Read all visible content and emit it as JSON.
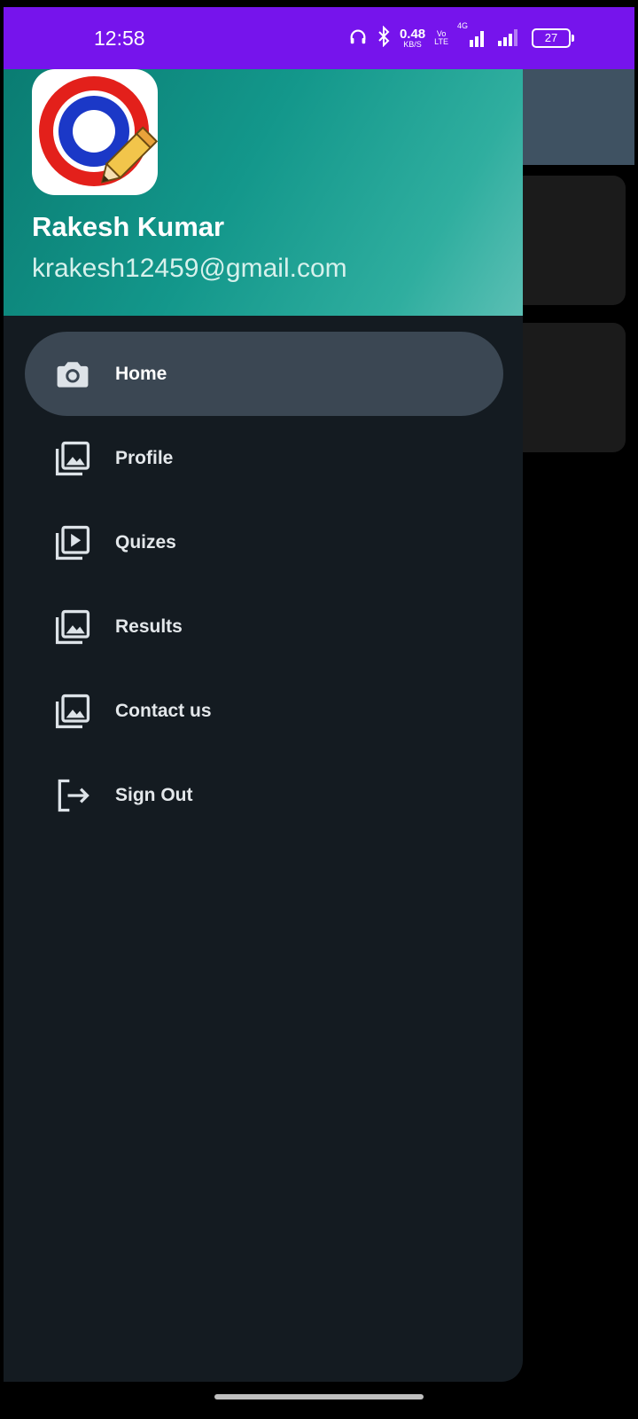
{
  "status_bar": {
    "time": "12:58",
    "net_speed": "0.48",
    "net_speed_unit": "KB/S",
    "volte_top": "Vo",
    "volte_bottom": "LTE",
    "network": "4G",
    "battery": "27"
  },
  "drawer": {
    "user_name": "Rakesh Kumar",
    "user_email": "krakesh12459@gmail.com",
    "items": [
      {
        "label": "Home",
        "icon": "camera-icon",
        "active": true
      },
      {
        "label": "Profile",
        "icon": "photo-library-icon",
        "active": false
      },
      {
        "label": "Quizes",
        "icon": "video-library-icon",
        "active": false
      },
      {
        "label": "Results",
        "icon": "photo-library-icon",
        "active": false
      },
      {
        "label": "Contact us",
        "icon": "photo-library-icon",
        "active": false
      },
      {
        "label": "Sign Out",
        "icon": "sign-out-icon",
        "active": false
      }
    ]
  },
  "colors": {
    "status_bar": "#7614ec",
    "drawer_bg": "#141b21",
    "header_gradient_start": "#0a7c72",
    "header_gradient_end": "#5bbfb4",
    "active_item_bg": "#3b4753",
    "logo_red": "#e3201b",
    "logo_blue": "#1b38c7"
  }
}
